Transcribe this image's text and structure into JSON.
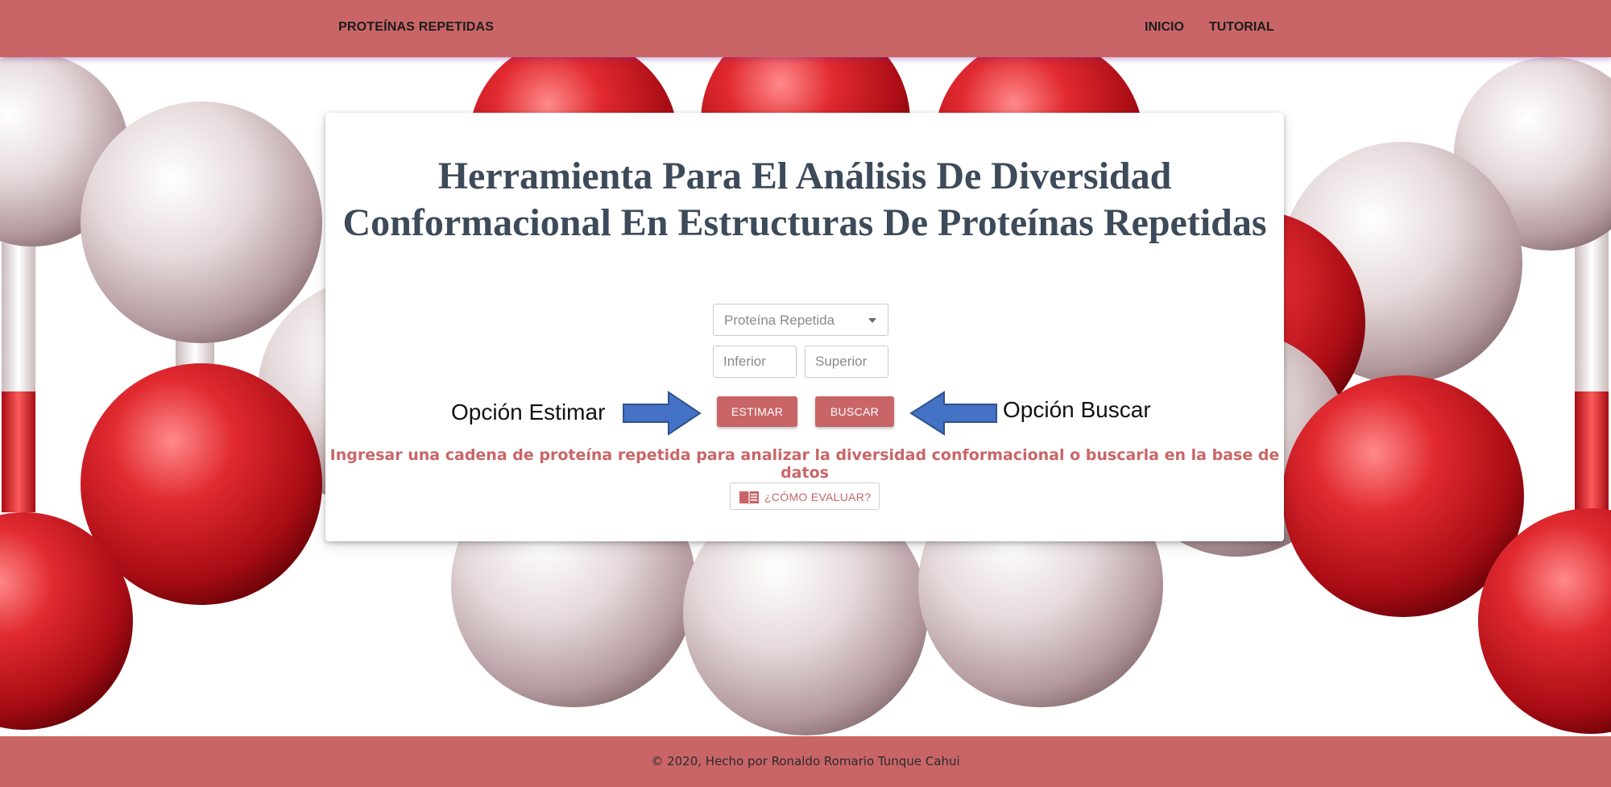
{
  "navbar": {
    "brand": "PROTEÍNAS REPETIDAS",
    "links": [
      {
        "label": "INICIO"
      },
      {
        "label": "TUTORIAL"
      }
    ]
  },
  "main": {
    "title": "Herramienta Para El Análisis De Diversidad Conformacional En Estructuras De Proteínas Repetidas",
    "protein_select": {
      "placeholder": "Proteína Repetida",
      "icon": "caret-down-icon"
    },
    "inferior_input": {
      "placeholder": "Inferior",
      "value": ""
    },
    "superior_input": {
      "placeholder": "Superior",
      "value": ""
    },
    "estimate_button": "ESTIMAR",
    "search_button": "BUSCAR",
    "helper_text": "Ingresar una cadena de proteína repetida para analizar la diversidad conformacional o buscarla en la base de datos",
    "howto_button": {
      "label": "¿CÓMO EVALUAR?",
      "icon": "book-icon"
    }
  },
  "annotations": {
    "estimate_label": "Opción Estimar",
    "search_label": "Opción Buscar",
    "arrow_color": "#4472c4"
  },
  "footer": {
    "text": "© 2020, Hecho por Ronaldo Romario Tunque Cahui"
  },
  "colors": {
    "accent": "#c96567",
    "title": "#3d4a5a"
  }
}
